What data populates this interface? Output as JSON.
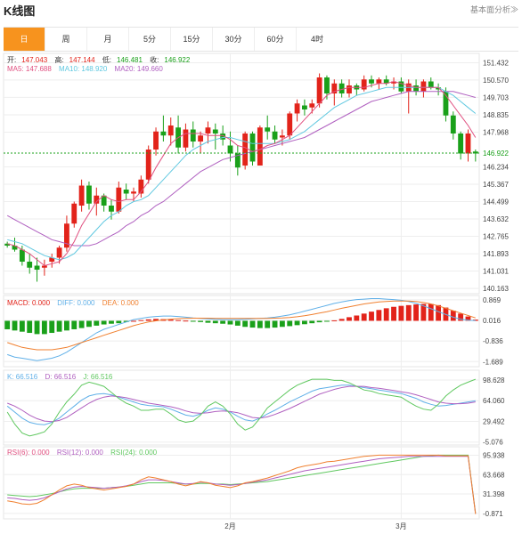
{
  "header": {
    "title": "K线图",
    "link": "基本面分析≫"
  },
  "tabs": [
    {
      "label": "日",
      "active": true
    },
    {
      "label": "周",
      "active": false
    },
    {
      "label": "月",
      "active": false
    },
    {
      "label": "5分",
      "active": false
    },
    {
      "label": "15分",
      "active": false
    },
    {
      "label": "30分",
      "active": false
    },
    {
      "label": "60分",
      "active": false
    },
    {
      "label": "4时",
      "active": false
    }
  ],
  "ohlc_legend": {
    "open_label": "开:",
    "open": "147.043",
    "high_label": "高:",
    "high": "147.144",
    "low_label": "低:",
    "low": "146.481",
    "close_label": "收:",
    "close": "146.922"
  },
  "ma_legend": {
    "ma5": "MA5: 147.688",
    "ma10": "MA10: 148.920",
    "ma20": "MA20: 149.660"
  },
  "macd_legend": {
    "macd": "MACD: 0.000",
    "diff": "DIFF: 0.000",
    "dea": "DEA: 0.000"
  },
  "kdj_legend": {
    "k": "K: 66.516",
    "d": "D: 66.516",
    "j": "J: 66.516"
  },
  "rsi_legend": {
    "rsi6": "RSI(6): 0.000",
    "rsi12": "RSI(12): 0.000",
    "rsi24": "RSI(24): 0.000"
  },
  "colors": {
    "up": "#e2231a",
    "down": "#1aa01a",
    "ma5": "#e05080",
    "ma10": "#60c8e0",
    "ma20": "#b060c0",
    "diff": "#60b0e8",
    "dea": "#f08030",
    "accent": "#f7931e"
  },
  "chart_data": {
    "type": "candlestick",
    "x_labels": [
      "2月",
      "3月"
    ],
    "current_price": "146.922",
    "price_axis": {
      "ticks": [
        "151.432",
        "150.570",
        "149.703",
        "148.835",
        "147.968",
        "146.234",
        "145.367",
        "144.499",
        "143.632",
        "142.765",
        "141.893",
        "141.031",
        "140.163"
      ],
      "ylim": [
        139.9,
        151.9
      ]
    },
    "candles": [
      [
        142.4,
        142.5,
        142.2,
        142.3
      ],
      [
        142.3,
        142.7,
        142.0,
        142.1
      ],
      [
        142.1,
        142.3,
        141.3,
        141.5
      ],
      [
        141.5,
        141.9,
        140.9,
        141.2
      ],
      [
        141.3,
        141.7,
        140.5,
        141.1
      ],
      [
        141.2,
        141.6,
        140.8,
        141.3
      ],
      [
        141.5,
        141.9,
        141.2,
        141.7
      ],
      [
        141.7,
        142.3,
        141.4,
        142.2
      ],
      [
        142.2,
        143.8,
        142.0,
        143.4
      ],
      [
        143.4,
        144.5,
        143.2,
        144.4
      ],
      [
        144.3,
        145.6,
        144.0,
        145.3
      ],
      [
        145.3,
        145.5,
        144.1,
        144.4
      ],
      [
        144.4,
        145.2,
        143.8,
        144.8
      ],
      [
        144.8,
        144.9,
        144.0,
        144.3
      ],
      [
        144.3,
        144.6,
        143.6,
        144.0
      ],
      [
        144.0,
        145.5,
        143.9,
        145.2
      ],
      [
        145.1,
        145.4,
        144.6,
        144.9
      ],
      [
        144.9,
        145.2,
        144.5,
        145.0
      ],
      [
        144.9,
        145.8,
        144.7,
        145.6
      ],
      [
        145.6,
        147.3,
        145.4,
        147.1
      ],
      [
        147.1,
        148.2,
        146.8,
        148.0
      ],
      [
        148.0,
        148.8,
        147.5,
        147.8
      ],
      [
        147.8,
        148.7,
        147.3,
        148.3
      ],
      [
        148.2,
        148.8,
        146.9,
        147.2
      ],
      [
        147.2,
        148.4,
        147.0,
        148.1
      ],
      [
        148.1,
        148.5,
        147.2,
        147.5
      ],
      [
        147.5,
        148.0,
        146.9,
        147.8
      ],
      [
        147.9,
        148.5,
        147.4,
        148.2
      ],
      [
        148.1,
        148.4,
        147.1,
        147.9
      ],
      [
        147.9,
        148.3,
        147.3,
        147.6
      ],
      [
        147.3,
        148.0,
        146.5,
        146.9
      ],
      [
        146.9,
        147.3,
        145.8,
        146.2
      ],
      [
        146.3,
        148.0,
        146.1,
        147.9
      ],
      [
        147.9,
        148.0,
        146.3,
        146.5
      ],
      [
        146.3,
        148.3,
        146.3,
        148.2
      ],
      [
        148.2,
        148.8,
        147.6,
        148.0
      ],
      [
        148.0,
        148.3,
        147.4,
        147.6
      ],
      [
        147.7,
        148.1,
        147.3,
        147.8
      ],
      [
        147.8,
        149.0,
        147.6,
        148.9
      ],
      [
        148.9,
        149.6,
        148.5,
        149.4
      ],
      [
        149.3,
        149.6,
        148.8,
        149.1
      ],
      [
        149.2,
        149.6,
        148.9,
        149.4
      ],
      [
        149.4,
        150.9,
        149.2,
        150.7
      ],
      [
        150.7,
        150.8,
        149.6,
        149.9
      ],
      [
        149.9,
        150.6,
        149.3,
        150.4
      ],
      [
        150.4,
        150.6,
        149.7,
        149.9
      ],
      [
        149.9,
        150.6,
        149.7,
        150.3
      ],
      [
        150.3,
        150.4,
        149.8,
        150.1
      ],
      [
        150.1,
        150.8,
        150.0,
        150.6
      ],
      [
        150.6,
        150.8,
        150.2,
        150.4
      ],
      [
        150.4,
        150.7,
        150.1,
        150.6
      ],
      [
        150.6,
        150.8,
        150.3,
        150.4
      ],
      [
        150.4,
        150.7,
        150.1,
        150.5
      ],
      [
        150.5,
        150.7,
        149.9,
        150.0
      ],
      [
        150.0,
        150.6,
        148.9,
        150.4
      ],
      [
        150.3,
        150.6,
        149.8,
        150.0
      ],
      [
        150.0,
        150.6,
        149.7,
        150.5
      ],
      [
        150.5,
        150.7,
        150.1,
        150.2
      ],
      [
        150.2,
        150.4,
        149.8,
        150.1
      ],
      [
        150.0,
        150.2,
        148.5,
        148.8
      ],
      [
        148.8,
        149.0,
        147.6,
        147.9
      ],
      [
        147.9,
        148.0,
        146.6,
        146.9
      ],
      [
        146.9,
        148.1,
        146.5,
        147.9
      ],
      [
        147.0,
        147.1,
        146.5,
        146.9
      ]
    ],
    "ma5": [
      142.4,
      142.3,
      142.1,
      141.9,
      141.6,
      141.3,
      141.4,
      141.5,
      141.9,
      142.5,
      143.3,
      143.9,
      144.5,
      144.8,
      144.6,
      144.5,
      144.6,
      144.6,
      145.0,
      145.5,
      146.2,
      146.8,
      147.4,
      147.7,
      147.9,
      147.9,
      147.9,
      147.8,
      147.8,
      147.8,
      147.6,
      147.3,
      147.2,
      147.0,
      147.1,
      147.3,
      147.4,
      147.6,
      147.8,
      148.2,
      148.6,
      149.0,
      149.4,
      149.8,
      150.0,
      150.1,
      150.2,
      150.2,
      150.2,
      150.3,
      150.4,
      150.4,
      150.5,
      150.4,
      150.3,
      150.2,
      150.2,
      150.2,
      150.2,
      149.8,
      149.3,
      148.8,
      148.3,
      147.7
    ],
    "ma10": [
      142.6,
      142.5,
      142.4,
      142.2,
      142.0,
      141.8,
      141.7,
      141.6,
      141.7,
      141.9,
      142.3,
      142.7,
      143.1,
      143.5,
      143.8,
      144.0,
      144.3,
      144.5,
      144.6,
      144.8,
      145.2,
      145.6,
      146.0,
      146.4,
      146.8,
      147.1,
      147.3,
      147.5,
      147.6,
      147.7,
      147.7,
      147.6,
      147.5,
      147.4,
      147.4,
      147.4,
      147.4,
      147.5,
      147.6,
      147.8,
      148.0,
      148.3,
      148.6,
      148.9,
      149.2,
      149.4,
      149.6,
      149.8,
      149.9,
      150.0,
      150.1,
      150.2,
      150.2,
      150.2,
      150.2,
      150.2,
      150.2,
      150.2,
      150.2,
      150.0,
      149.8,
      149.5,
      149.2,
      148.9
    ],
    "ma20": [
      143.8,
      143.6,
      143.4,
      143.2,
      143.0,
      142.8,
      142.6,
      142.5,
      142.4,
      142.3,
      142.3,
      142.3,
      142.4,
      142.6,
      142.8,
      143.0,
      143.3,
      143.5,
      143.8,
      144.0,
      144.3,
      144.5,
      144.8,
      145.1,
      145.4,
      145.7,
      146.0,
      146.2,
      146.4,
      146.6,
      146.7,
      146.8,
      146.9,
      147.0,
      147.1,
      147.2,
      147.3,
      147.4,
      147.5,
      147.6,
      147.7,
      147.9,
      148.1,
      148.3,
      148.5,
      148.7,
      148.9,
      149.1,
      149.3,
      149.5,
      149.6,
      149.7,
      149.8,
      149.9,
      150.0,
      150.0,
      150.0,
      150.0,
      150.0,
      150.0,
      150.0,
      149.9,
      149.8,
      149.7
    ],
    "macd_axis": {
      "ticks": [
        "0.869",
        "0.016",
        "-0.836",
        "-1.689"
      ],
      "ylim": [
        -1.9,
        1.05
      ]
    },
    "macd_hist": [
      -0.35,
      -0.4,
      -0.45,
      -0.5,
      -0.55,
      -0.55,
      -0.5,
      -0.45,
      -0.4,
      -0.35,
      -0.3,
      -0.25,
      -0.2,
      -0.15,
      -0.12,
      -0.1,
      -0.05,
      0.0,
      0.03,
      0.06,
      0.08,
      0.07,
      0.05,
      0.03,
      0.01,
      -0.02,
      -0.05,
      -0.08,
      -0.1,
      -0.12,
      -0.15,
      -0.2,
      -0.25,
      -0.28,
      -0.3,
      -0.3,
      -0.28,
      -0.25,
      -0.22,
      -0.18,
      -0.14,
      -0.1,
      -0.06,
      -0.02,
      0.02,
      0.08,
      0.15,
      0.22,
      0.3,
      0.38,
      0.45,
      0.52,
      0.58,
      0.62,
      0.65,
      0.68,
      0.7,
      0.7,
      0.65,
      0.55,
      0.42,
      0.3,
      0.18,
      0.05
    ],
    "diff": [
      -1.4,
      -1.5,
      -1.55,
      -1.6,
      -1.65,
      -1.6,
      -1.55,
      -1.45,
      -1.3,
      -1.1,
      -0.9,
      -0.7,
      -0.5,
      -0.35,
      -0.25,
      -0.15,
      -0.05,
      0.05,
      0.1,
      0.15,
      0.18,
      0.2,
      0.2,
      0.18,
      0.15,
      0.12,
      0.1,
      0.08,
      0.06,
      0.05,
      0.05,
      0.05,
      0.06,
      0.08,
      0.1,
      0.12,
      0.15,
      0.2,
      0.25,
      0.32,
      0.4,
      0.48,
      0.56,
      0.64,
      0.72,
      0.78,
      0.84,
      0.88,
      0.9,
      0.92,
      0.92,
      0.9,
      0.88,
      0.85,
      0.8,
      0.72,
      0.62,
      0.5,
      0.38,
      0.26,
      0.15,
      0.07,
      0.03,
      0.01
    ],
    "dea": [
      -0.9,
      -1.0,
      -1.1,
      -1.15,
      -1.2,
      -1.2,
      -1.2,
      -1.15,
      -1.1,
      -1.0,
      -0.9,
      -0.8,
      -0.7,
      -0.6,
      -0.5,
      -0.4,
      -0.3,
      -0.2,
      -0.12,
      -0.05,
      0.0,
      0.04,
      0.07,
      0.09,
      0.1,
      0.11,
      0.11,
      0.11,
      0.1,
      0.1,
      0.1,
      0.1,
      0.1,
      0.1,
      0.1,
      0.1,
      0.11,
      0.12,
      0.14,
      0.17,
      0.21,
      0.26,
      0.32,
      0.38,
      0.45,
      0.52,
      0.58,
      0.64,
      0.7,
      0.74,
      0.78,
      0.8,
      0.82,
      0.82,
      0.82,
      0.8,
      0.76,
      0.7,
      0.62,
      0.52,
      0.42,
      0.32,
      0.22,
      0.12
    ],
    "kdj_axis": {
      "ticks": [
        "98.628",
        "64.060",
        "29.492",
        "-5.076"
      ],
      "ylim": [
        -10,
        115
      ]
    },
    "k": [
      55,
      45,
      35,
      28,
      25,
      24,
      28,
      35,
      45,
      55,
      65,
      72,
      75,
      76,
      74,
      70,
      66,
      62,
      58,
      56,
      55,
      54,
      50,
      45,
      40,
      38,
      42,
      48,
      52,
      50,
      45,
      38,
      32,
      30,
      35,
      42,
      48,
      55,
      62,
      68,
      74,
      80,
      84,
      86,
      88,
      90,
      90,
      88,
      86,
      84,
      82,
      80,
      78,
      76,
      72,
      68,
      62,
      58,
      55,
      56,
      58,
      60,
      62,
      64
    ],
    "d": [
      60,
      55,
      48,
      40,
      34,
      30,
      29,
      31,
      36,
      44,
      52,
      60,
      66,
      70,
      72,
      71,
      69,
      66,
      63,
      60,
      58,
      56,
      54,
      51,
      47,
      44,
      43,
      44,
      46,
      47,
      46,
      44,
      40,
      36,
      35,
      37,
      41,
      46,
      51,
      57,
      63,
      69,
      75,
      79,
      83,
      86,
      88,
      88,
      88,
      86,
      85,
      83,
      81,
      79,
      77,
      74,
      70,
      66,
      62,
      60,
      59,
      59,
      60,
      62
    ],
    "j": [
      45,
      25,
      10,
      5,
      8,
      12,
      25,
      45,
      62,
      75,
      90,
      95,
      92,
      88,
      78,
      68,
      60,
      55,
      48,
      48,
      50,
      50,
      42,
      32,
      28,
      30,
      40,
      55,
      62,
      55,
      42,
      25,
      15,
      20,
      35,
      52,
      62,
      72,
      82,
      90,
      95,
      100,
      100,
      100,
      98,
      98,
      94,
      88,
      82,
      80,
      76,
      74,
      72,
      70,
      62,
      55,
      50,
      48,
      58,
      72,
      82,
      90,
      95,
      100
    ],
    "rsi_axis": {
      "ticks": [
        "95.938",
        "63.668",
        "31.398",
        "-0.871"
      ],
      "ylim": [
        -10,
        110
      ]
    },
    "rsi6": [
      20,
      18,
      15,
      14,
      16,
      22,
      30,
      38,
      45,
      48,
      46,
      42,
      40,
      38,
      40,
      42,
      44,
      48,
      55,
      60,
      58,
      55,
      52,
      48,
      45,
      48,
      52,
      50,
      46,
      44,
      42,
      45,
      50,
      52,
      55,
      58,
      62,
      66,
      70,
      75,
      78,
      80,
      82,
      85,
      86,
      88,
      90,
      92,
      94,
      95,
      96,
      96,
      96,
      96,
      96,
      96,
      96,
      96,
      96,
      95,
      95,
      95,
      95,
      -2
    ],
    "rsi12": [
      25,
      24,
      22,
      21,
      22,
      25,
      30,
      35,
      40,
      43,
      44,
      43,
      42,
      41,
      42,
      43,
      45,
      48,
      52,
      55,
      55,
      54,
      52,
      50,
      48,
      49,
      51,
      50,
      48,
      47,
      46,
      47,
      49,
      51,
      53,
      55,
      58,
      61,
      64,
      67,
      70,
      72,
      74,
      76,
      78,
      80,
      82,
      84,
      86,
      88,
      90,
      91,
      92,
      93,
      94,
      94,
      94,
      94,
      94,
      94,
      94,
      94,
      94,
      -1
    ],
    "rsi24": [
      30,
      29,
      28,
      27,
      28,
      30,
      32,
      35,
      38,
      40,
      41,
      41,
      41,
      41,
      42,
      43,
      44,
      46,
      48,
      50,
      50,
      50,
      50,
      49,
      48,
      48,
      49,
      49,
      48,
      48,
      47,
      48,
      49,
      50,
      51,
      52,
      54,
      56,
      58,
      60,
      62,
      64,
      66,
      68,
      70,
      72,
      74,
      76,
      78,
      80,
      82,
      84,
      86,
      88,
      90,
      92,
      94,
      95,
      96,
      96,
      96,
      96,
      96,
      0
    ]
  }
}
